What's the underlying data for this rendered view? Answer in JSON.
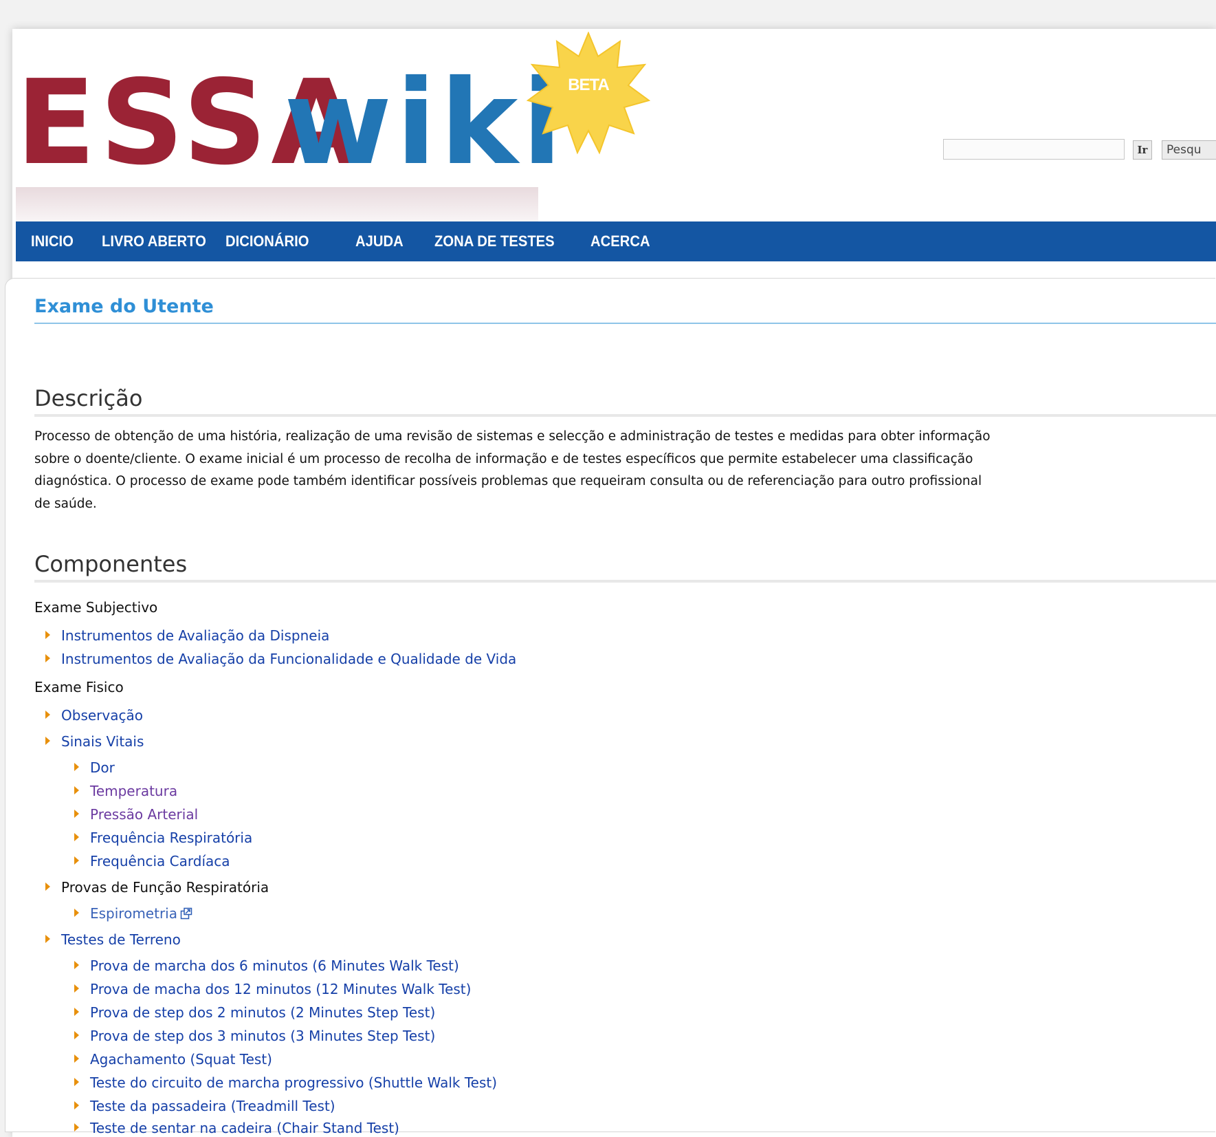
{
  "header": {
    "logo": {
      "part1": "ESSA",
      "part2": "wiki",
      "badge": "BETA"
    },
    "search": {
      "value": "",
      "go_label": "Ir",
      "search_label": "Pesqu"
    }
  },
  "nav": {
    "items": [
      "INICIO",
      "LIVRO ABERTO",
      "DICIONÁRIO",
      "AJUDA",
      "ZONA DE TESTES",
      "ACERCA"
    ]
  },
  "page": {
    "title": "Exame do Utente",
    "description": {
      "heading": "Descrição",
      "lines": [
        "Processo de obtenção de uma história, realização de uma revisão de sistemas e selecção e administração de testes e medidas para obter informação",
        "sobre o doente/cliente. O exame inicial é um processo de recolha de informação e de testes específicos que permite estabelecer uma classificação",
        "diagnóstica. O processo de exame pode também identificar possíveis problemas que requeiram consulta ou de referenciação para outro profissional",
        "de saúde."
      ]
    },
    "components": {
      "heading": "Componentes",
      "subjective": {
        "label": "Exame Subjectivo",
        "items": [
          "Instrumentos de Avaliação da Dispneia",
          "Instrumentos de Avaliação da Funcionalidade e Qualidade de Vida"
        ]
      },
      "physical": {
        "label": "Exame Fisico",
        "observacao": "Observação",
        "sinais_vitais": {
          "label": "Sinais Vitais",
          "items": [
            "Dor",
            "Temperatura",
            "Pressão Arterial",
            "Frequência Respiratória",
            "Frequência Cardíaca"
          ]
        },
        "provas": {
          "label": "Provas de Função Respiratória",
          "items": [
            "Espirometria"
          ]
        },
        "testes": {
          "label": "Testes de Terreno",
          "items": [
            "Prova de marcha dos 6 minutos (6 Minutes Walk Test)",
            "Prova de macha dos 12 minutos (12 Minutes Walk Test)",
            "Prova de step dos 2 minutos (2 Minutes Step Test)",
            "Prova de step dos 3 minutos (3 Minutes Step Test)",
            "Agachamento (Squat Test)",
            "Teste do circuito de marcha progressivo (Shuttle Walk Test)",
            "Teste da passadeira (Treadmill Test)",
            "Teste de sentar na cadeira (Chair Stand Test)"
          ]
        }
      }
    }
  },
  "colors": {
    "nav_bg": "#1456a3",
    "logo_red": "#9b2335",
    "logo_blue": "#2276b5",
    "title_blue": "#2f8fd6",
    "link": "#1640a8",
    "visited_link": "#6b3aa0",
    "bullet": "#e8900c"
  }
}
